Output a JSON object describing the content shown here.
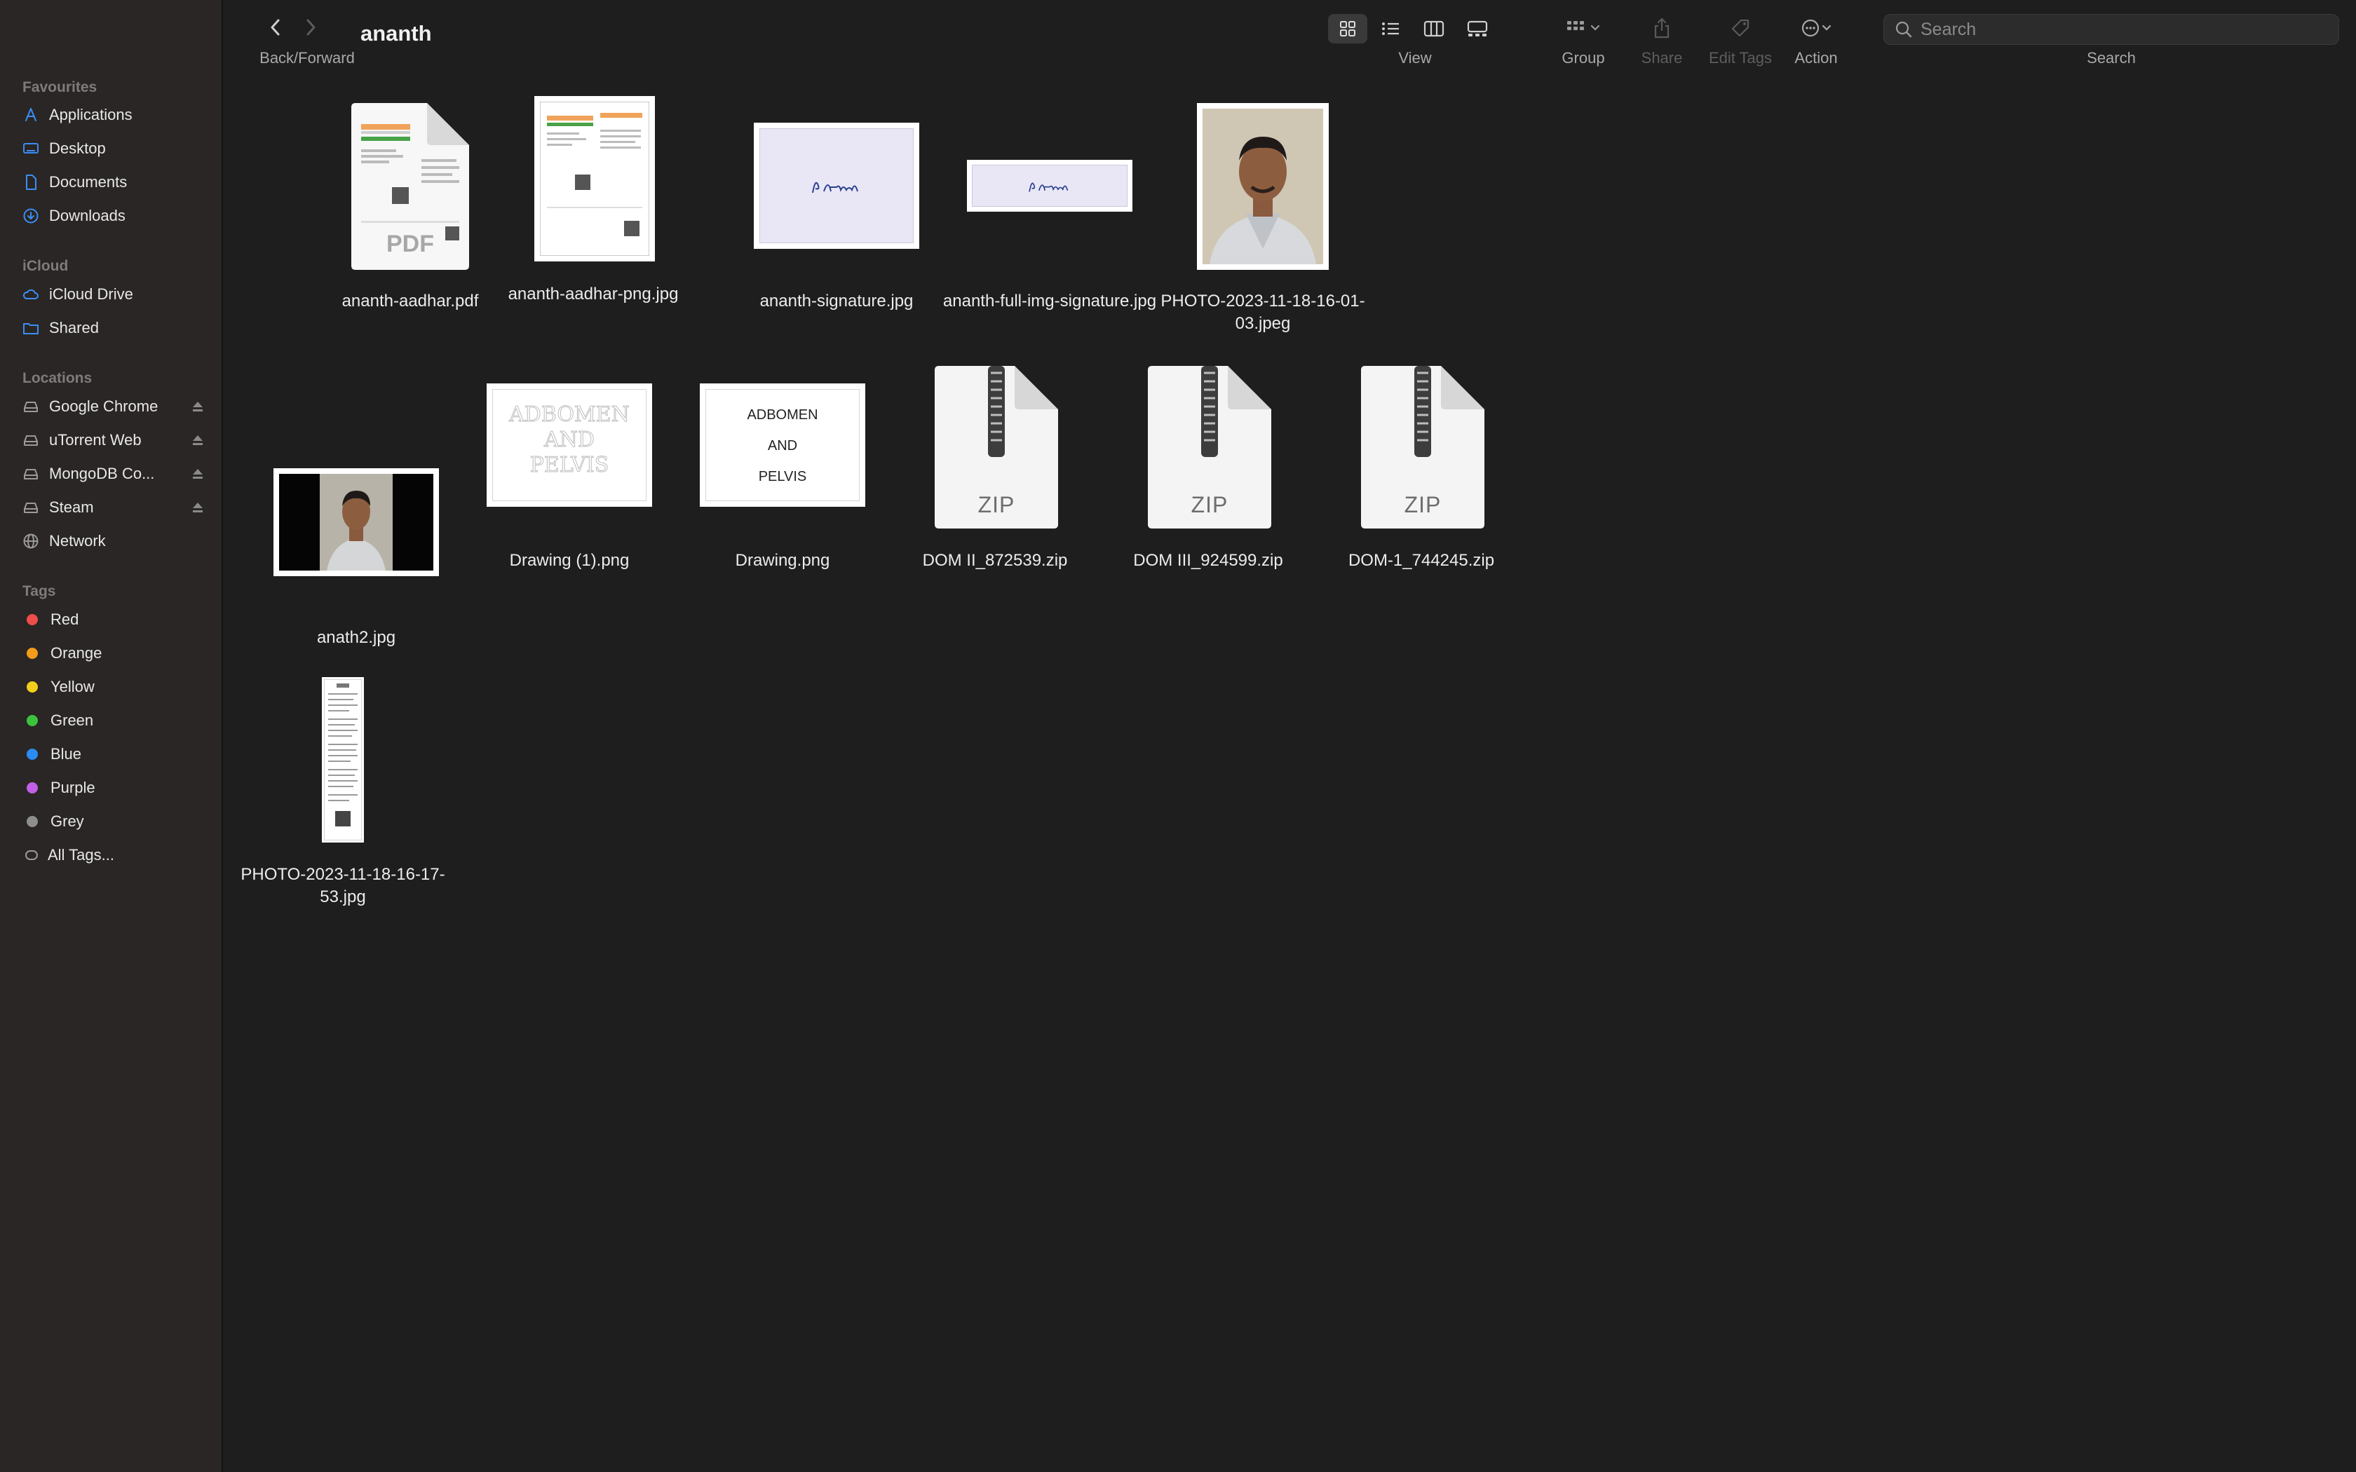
{
  "window": {
    "title": "ananth"
  },
  "toolbar": {
    "back_forward_label": "Back/Forward",
    "view_label": "View",
    "group_label": "Group",
    "share_label": "Share",
    "edit_tags_label": "Edit Tags",
    "action_label": "Action",
    "search_label": "Search",
    "search_placeholder": "Search",
    "selected_view": "icon"
  },
  "sidebar": {
    "favourites_header": "Favourites",
    "favourites": [
      {
        "label": "Applications",
        "icon": "applications-icon"
      },
      {
        "label": "Desktop",
        "icon": "desktop-icon"
      },
      {
        "label": "Documents",
        "icon": "document-icon"
      },
      {
        "label": "Downloads",
        "icon": "downloads-icon"
      }
    ],
    "icloud_header": "iCloud",
    "icloud": [
      {
        "label": "iCloud Drive",
        "icon": "cloud-icon"
      },
      {
        "label": "Shared",
        "icon": "shared-folder-icon"
      }
    ],
    "locations_header": "Locations",
    "locations": [
      {
        "label": "Google Chrome",
        "icon": "drive-icon",
        "ejectable": true
      },
      {
        "label": "uTorrent Web",
        "icon": "drive-icon",
        "ejectable": true
      },
      {
        "label": "MongoDB Co...",
        "icon": "drive-icon",
        "ejectable": true
      },
      {
        "label": "Steam",
        "icon": "drive-icon",
        "ejectable": true
      },
      {
        "label": "Network",
        "icon": "globe-icon",
        "ejectable": false
      }
    ],
    "tags_header": "Tags",
    "tags": [
      {
        "label": "Red",
        "color": "#ee4d4a"
      },
      {
        "label": "Orange",
        "color": "#f39c19"
      },
      {
        "label": "Yellow",
        "color": "#f2ce1c"
      },
      {
        "label": "Green",
        "color": "#3bc33e"
      },
      {
        "label": "Blue",
        "color": "#2b8cf3"
      },
      {
        "label": "Purple",
        "color": "#c35ee6"
      },
      {
        "label": "Grey",
        "color": "#8e8e8e"
      },
      {
        "label": "All Tags...",
        "color": ""
      }
    ]
  },
  "files": [
    {
      "name": "ananth-aadhar.pdf",
      "kind": "pdf",
      "badge": "PDF"
    },
    {
      "name": "ananth-aadhar-png.jpg",
      "kind": "image"
    },
    {
      "name": "ananth-signature.jpg",
      "kind": "image"
    },
    {
      "name": "ananth-full-img-signature.jpg",
      "kind": "image"
    },
    {
      "name": "PHOTO-2023-11-18-16-01-03.jpeg",
      "kind": "image"
    },
    {
      "name": "anath2.jpg",
      "kind": "image"
    },
    {
      "name": "Drawing (1).png",
      "kind": "image",
      "text": [
        "ADBOMEN",
        "AND",
        "PELVIS"
      ]
    },
    {
      "name": "Drawing.png",
      "kind": "image",
      "text": [
        "ADBOMEN",
        "AND",
        "PELVIS"
      ]
    },
    {
      "name": "DOM II_872539.zip",
      "kind": "zip",
      "badge": "ZIP"
    },
    {
      "name": "DOM III_924599.zip",
      "kind": "zip",
      "badge": "ZIP"
    },
    {
      "name": "DOM-1_744245.zip",
      "kind": "zip",
      "badge": "ZIP"
    },
    {
      "name": "PHOTO-2023-11-18-16-17-53.jpg",
      "kind": "image"
    }
  ],
  "colors": {
    "accent": "#2b8cf3",
    "window_bg": "#1e1e1e",
    "sidebar_bg": "#2a2625"
  }
}
